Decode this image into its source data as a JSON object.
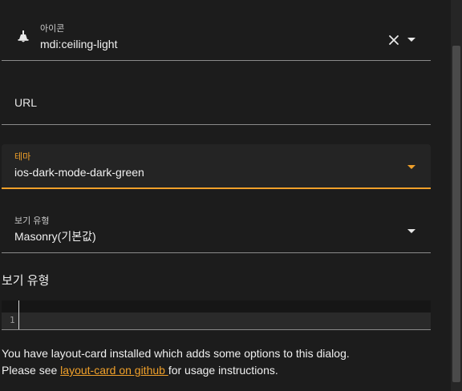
{
  "icon_field": {
    "label": "아이콘",
    "value": "mdi:ceiling-light",
    "icon": "ceiling-light-icon"
  },
  "url_field": {
    "label": "URL"
  },
  "theme_field": {
    "label": "테마",
    "value": "ios-dark-mode-dark-green",
    "accent": "#f0a02a"
  },
  "view_type_field": {
    "label": "보기 유형",
    "value": "Masonry(기본값)"
  },
  "section": {
    "title": "보기 유형"
  },
  "editor": {
    "line_number": "1"
  },
  "info": {
    "line1": "You have layout-card installed which adds some options to this dialog.",
    "line2_prefix": "Please see ",
    "link_text": "layout-card on github ",
    "line2_suffix": "for usage instructions."
  }
}
